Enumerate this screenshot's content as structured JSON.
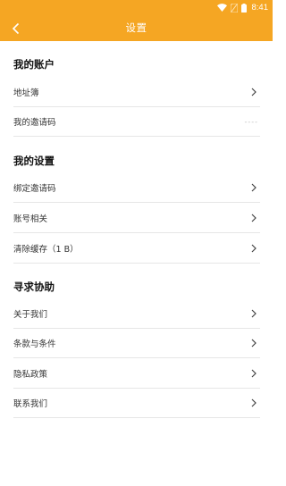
{
  "status_bar": {
    "time": "8:41"
  },
  "app_bar": {
    "title": "设置"
  },
  "sections": [
    {
      "title": "我的账户",
      "items": [
        {
          "label": "地址簿"
        },
        {
          "label": "我的邀请码",
          "value": "----"
        }
      ]
    },
    {
      "title": "我的设置",
      "items": [
        {
          "label": "绑定邀请码"
        },
        {
          "label": "账号相关"
        },
        {
          "label": "清除缓存（1 B）"
        }
      ]
    },
    {
      "title": "寻求协助",
      "items": [
        {
          "label": "关于我们"
        },
        {
          "label": "条款与条件"
        },
        {
          "label": "隐私政策"
        },
        {
          "label": "联系我们"
        }
      ]
    }
  ],
  "colors": {
    "accent": "#f5a623",
    "divider": "#e6e6e6"
  }
}
